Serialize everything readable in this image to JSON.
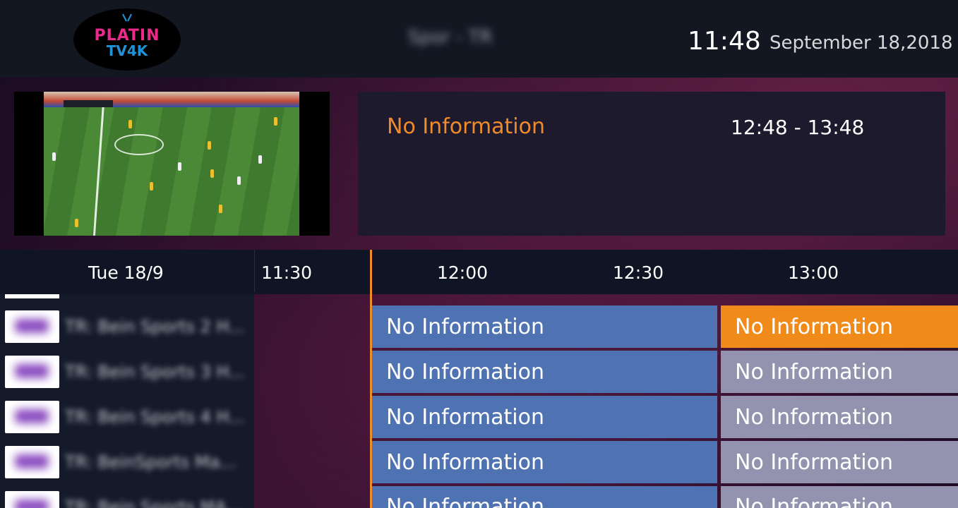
{
  "header": {
    "logo": {
      "line1": "PLATIN",
      "line2": "TV4K"
    },
    "channel_title": "Spor - TR",
    "clock": "11:48",
    "date": "September 18,2018"
  },
  "preview": {
    "program_title": "No Information",
    "time_range": "12:48 - 13:48"
  },
  "timeline": {
    "date_label": "Tue 18/9",
    "slots": [
      "11:30",
      "12:00",
      "12:30",
      "13:00"
    ]
  },
  "channels": [
    {
      "name": "TR: Bein Sports 2 H..."
    },
    {
      "name": "TR: Bein Sports 3 H..."
    },
    {
      "name": "TR: Bein Sports 4 H..."
    },
    {
      "name": "TR: BeinSports Ma..."
    },
    {
      "name": "TR: Bein Sports MA..."
    }
  ],
  "programs": [
    {
      "current": "No Information",
      "next": "No Information"
    },
    {
      "current": "No Information",
      "next": "No Information"
    },
    {
      "current": "No Information",
      "next": "No Information"
    },
    {
      "current": "No Information",
      "next": "No Information"
    },
    {
      "current": "No Information",
      "next": "No Information"
    }
  ],
  "colors": {
    "accent": "#f08b2c",
    "program_blue": "#4f72b2",
    "program_grey": "#9393b0",
    "header_bg": "#121722"
  }
}
